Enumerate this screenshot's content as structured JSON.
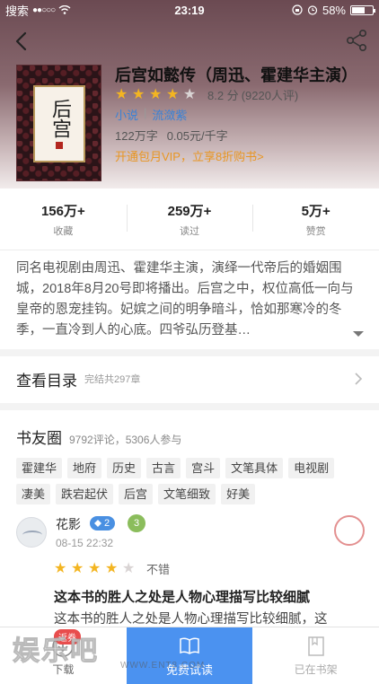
{
  "status_bar": {
    "carrier": "搜索",
    "signal_dots": "●●○○○",
    "time": "23:19",
    "battery": "58%"
  },
  "nav": {
    "back_icon": "chevron-left-icon",
    "share_icon": "share-icon"
  },
  "book": {
    "title": "后宫如懿传（周迅、霍建华主演）",
    "cover_title": "后宫",
    "rating_stars": 4,
    "rating_max": 5,
    "score": "8.2 分",
    "reviews": "(9220人评)",
    "category": "小说",
    "author": "流潋紫",
    "word_count": "122万字",
    "price": "0.05元/千字",
    "vip_promo": "开通包月VIP，立享8折购书>"
  },
  "stats": [
    {
      "value": "156万+",
      "label": "收藏"
    },
    {
      "value": "259万+",
      "label": "读过"
    },
    {
      "value": "5万+",
      "label": "赞赏"
    }
  ],
  "description": "同名电视剧由周迅、霍建华主演，演绎一代帝后的婚姻围城，2018年8月20号即将播出。后宫之中，权位高低一向与皇帝的恩宠挂钩。妃嫔之间的明争暗斗，恰如那寒冷的冬季，一直冷到人的心底。四爷弘历登基…",
  "toc": {
    "label": "查看目录",
    "count": "完结共297章"
  },
  "club": {
    "title": "书友圈",
    "summary": "9792评论，5306人参与",
    "tags": [
      "霍建华",
      "地府",
      "历史",
      "古言",
      "宫斗",
      "文笔具体",
      "电视剧",
      "凄美",
      "跌宕起伏",
      "后宫",
      "文笔细致",
      "好美"
    ]
  },
  "comment": {
    "user": "花影",
    "level": "2",
    "medal": "3",
    "date": "08-15 22:32",
    "stars": 4,
    "verdict": "不错",
    "heading": "这本书的胜人之处是人物心理描写比较细腻",
    "body": "这本书的胜人之处是人物心理描写比较细腻，这"
  },
  "bottom_bar": {
    "download": "下载",
    "download_badge": "返券",
    "read": "免费试读",
    "shelf": "已在书架"
  },
  "watermark": {
    "brand": "娱乐吧",
    "url": "WWW.ENT8.COM"
  },
  "colors": {
    "accent": "#4b92f0",
    "star": "#f3b521",
    "promo": "#e89623",
    "link": "#3a82d6"
  }
}
